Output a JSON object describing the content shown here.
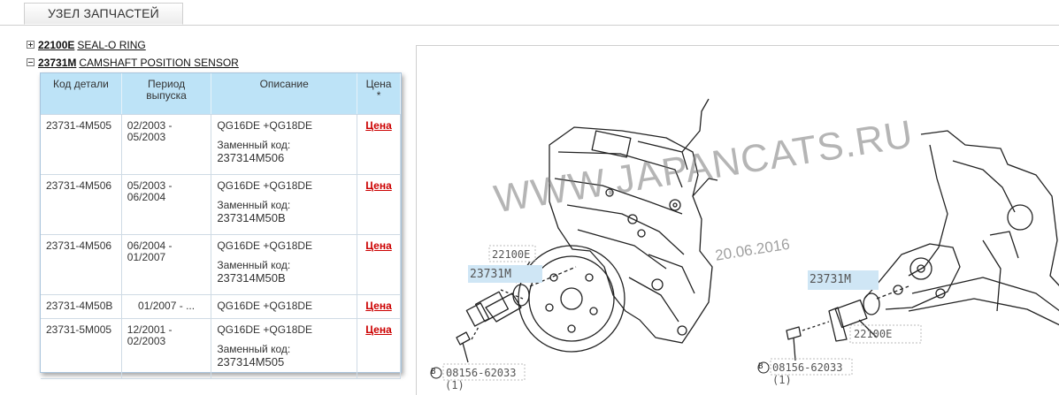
{
  "tab": {
    "label": "УЗЕЛ ЗАПЧАСТЕЙ"
  },
  "tree": [
    {
      "code": "22100E",
      "name": "SEAL-O RING",
      "state": "collapsed"
    },
    {
      "code": "23731M",
      "name": "CAMSHAFT POSITION SENSOR",
      "state": "expanded"
    }
  ],
  "table": {
    "headers": {
      "code": "Код детали",
      "period": "Период выпуска",
      "description": "Описание",
      "price": "Цена *"
    },
    "rows": [
      {
        "code": "23731-4M505",
        "period": "02/2003 - 05/2003",
        "description": "QG16DE +QG18DE",
        "replacement_label": "Заменный код:",
        "replacement_code": "237314M506",
        "price": "Цена"
      },
      {
        "code": "23731-4M506",
        "period": "05/2003 - 06/2004",
        "description": "QG16DE +QG18DE",
        "replacement_label": "Заменный код:",
        "replacement_code": "237314M50B",
        "price": "Цена"
      },
      {
        "code": "23731-4M506",
        "period": "06/2004 - 01/2007",
        "description": "QG16DE +QG18DE",
        "replacement_label": "Заменный код:",
        "replacement_code": "237314M50B",
        "price": "Цена"
      },
      {
        "code": "23731-4M50B",
        "period": "01/2007 - ...",
        "description": "QG16DE +QG18DE",
        "replacement_label": "",
        "replacement_code": "",
        "price": "Цена"
      },
      {
        "code": "23731-5M005",
        "period": "12/2001 - 02/2003",
        "description": "QG16DE +QG18DE",
        "replacement_label": "Заменный код:",
        "replacement_code": "237314M505",
        "price": "Цена"
      }
    ]
  },
  "diagram": {
    "watermark": "WWW.JAPANCATS.RU",
    "date": "20.06.2016",
    "labels": {
      "left_seal": "22100E",
      "left_sensor": "23731M",
      "left_bolt": "08156-62033",
      "left_qty": "(1)",
      "right_sensor": "23731M",
      "right_seal": "22100E",
      "right_bolt": "08156-62033",
      "right_qty": "(1)",
      "bolt_marker": "B"
    },
    "colors": {
      "highlight": "#cfe6f5",
      "line": "#222222"
    }
  }
}
